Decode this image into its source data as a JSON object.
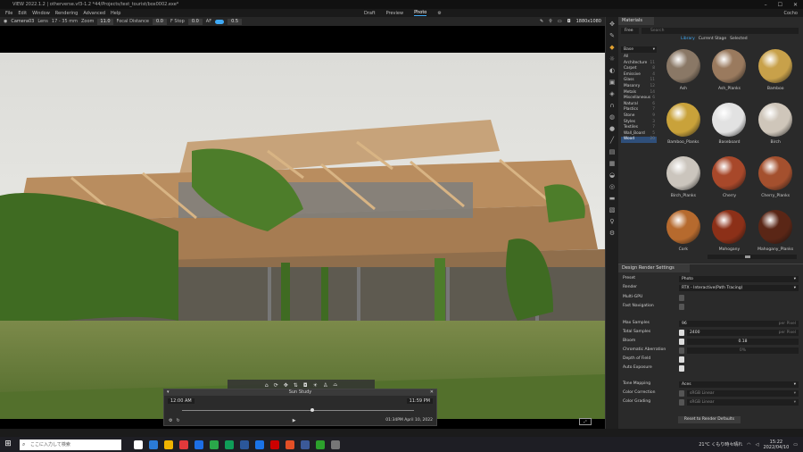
{
  "app": {
    "title": "VIEW 2022.1.2 | otherverse.vf3-1.2 *44/Projects/test_tourist/box0002.exe*",
    "menus": [
      "File",
      "Edit",
      "Window",
      "Rendering",
      "Advanced",
      "Help"
    ],
    "modes": [
      "Draft",
      "Preview",
      "Photo"
    ],
    "active_mode": "Photo",
    "user": "Cocho"
  },
  "viewport": {
    "camera": "Camera03",
    "lens_label": "Lens",
    "lens_value": "17 - 35 mm",
    "zoom_label": "Zoom",
    "zoom_value": "11.0",
    "focal_label": "Focal Distance",
    "focal_value": "0.0",
    "fstop_label": "F Stop",
    "fstop_value": "0.0",
    "af_label": "AF",
    "af_value": "0.5",
    "resolution": "1880x1080"
  },
  "sun_study": {
    "title": "Sun Study",
    "start_time": "12:00 AM",
    "end_time": "11:59 PM",
    "date": "01:34PM April 10, 2022",
    "position": 0.56
  },
  "nav": {
    "icons": [
      "home-icon",
      "orbit-icon",
      "pan-icon",
      "walk-icon",
      "camera-icon",
      "sun-icon",
      "person-icon",
      "hat-icon"
    ]
  },
  "materials": {
    "tab": "Materials",
    "free_label": "Free",
    "search_placeholder": "Search",
    "subtabs": [
      "Library",
      "Current Stage",
      "Selected"
    ],
    "category_dropdown": "Base",
    "categories": [
      {
        "name": "All",
        "count": ""
      },
      {
        "name": "Architecture",
        "count": "11"
      },
      {
        "name": "Carpet",
        "count": "8"
      },
      {
        "name": "Emissive",
        "count": "4"
      },
      {
        "name": "Glass",
        "count": "11"
      },
      {
        "name": "Masonry",
        "count": "12"
      },
      {
        "name": "Metals",
        "count": "14"
      },
      {
        "name": "Miscellaneous",
        "count": "6"
      },
      {
        "name": "Natural",
        "count": "6"
      },
      {
        "name": "Plastics",
        "count": "7"
      },
      {
        "name": "Stone",
        "count": "9"
      },
      {
        "name": "Styles",
        "count": "3"
      },
      {
        "name": "Textiles",
        "count": "7"
      },
      {
        "name": "Wall_Board",
        "count": "5"
      },
      {
        "name": "Wood",
        "count": "20"
      }
    ],
    "selected_category": "Wood",
    "swatches": [
      {
        "name": "Ash",
        "color": "#8a7866"
      },
      {
        "name": "Ash_Planks",
        "color": "#9a7a5e"
      },
      {
        "name": "Bamboo",
        "color": "#c8a14a"
      },
      {
        "name": "Bamboo_Planks",
        "color": "#c9a23a"
      },
      {
        "name": "Baseboard",
        "color": "#e2e2e2"
      },
      {
        "name": "Birch",
        "color": "#cfc6ba"
      },
      {
        "name": "Birch_Planks",
        "color": "#cbc5bd"
      },
      {
        "name": "Cherry",
        "color": "#a8482a"
      },
      {
        "name": "Cherry_Planks",
        "color": "#a4502e"
      },
      {
        "name": "Cork",
        "color": "#b66a2e"
      },
      {
        "name": "Mahogany",
        "color": "#8c3018"
      },
      {
        "name": "Mahogany_Planks",
        "color": "#5a2616"
      }
    ]
  },
  "render_settings": {
    "tab": "Design Render Settings",
    "preset_label": "Preset",
    "preset_value": "Photo",
    "render_label": "Render",
    "render_value": "RTX - Interactive(Path Tracing)",
    "multigpu_label": "Multi-GPU",
    "fastnav_label": "Fast Navigation",
    "maxsamples_label": "Max Samples",
    "maxsamples_value": "96",
    "maxsamples_unit": "per Pixel",
    "totalsamples_label": "Total Samples",
    "totalsamples_value": "2400",
    "totalsamples_unit": "per Pixel",
    "bloom_label": "Bloom",
    "bloom_value": "0.18",
    "ca_label": "Chromatic Aberration",
    "ca_value": "0%",
    "dof_label": "Depth of Field",
    "autoexp_label": "Auto Exposure",
    "tonemap_label": "Tone Mapping",
    "tonemap_value": "Aces",
    "colorcorr_label": "Color Correction",
    "colorcorr_value": "sRGB Linear",
    "colorgrade_label": "Color Grading",
    "colorgrade_value": "sRGB Linear",
    "reset_label": "Reset to Render Defaults"
  },
  "taskbar": {
    "search_placeholder": "ここに入力して検索",
    "app_colors": [
      "#ffffff",
      "#2b7bd6",
      "#f0b400",
      "#e2393b",
      "#1d6ee6",
      "#2aa84a",
      "#0f9d58",
      "#2b579a",
      "#1a73e8",
      "#c00",
      "#e34f26",
      "#3b5998",
      "#2ca02c",
      "#777"
    ],
    "clock_time": "15:22",
    "clock_date": "2022/04/10",
    "tray_text": "21°C くもり時々晴れ"
  }
}
